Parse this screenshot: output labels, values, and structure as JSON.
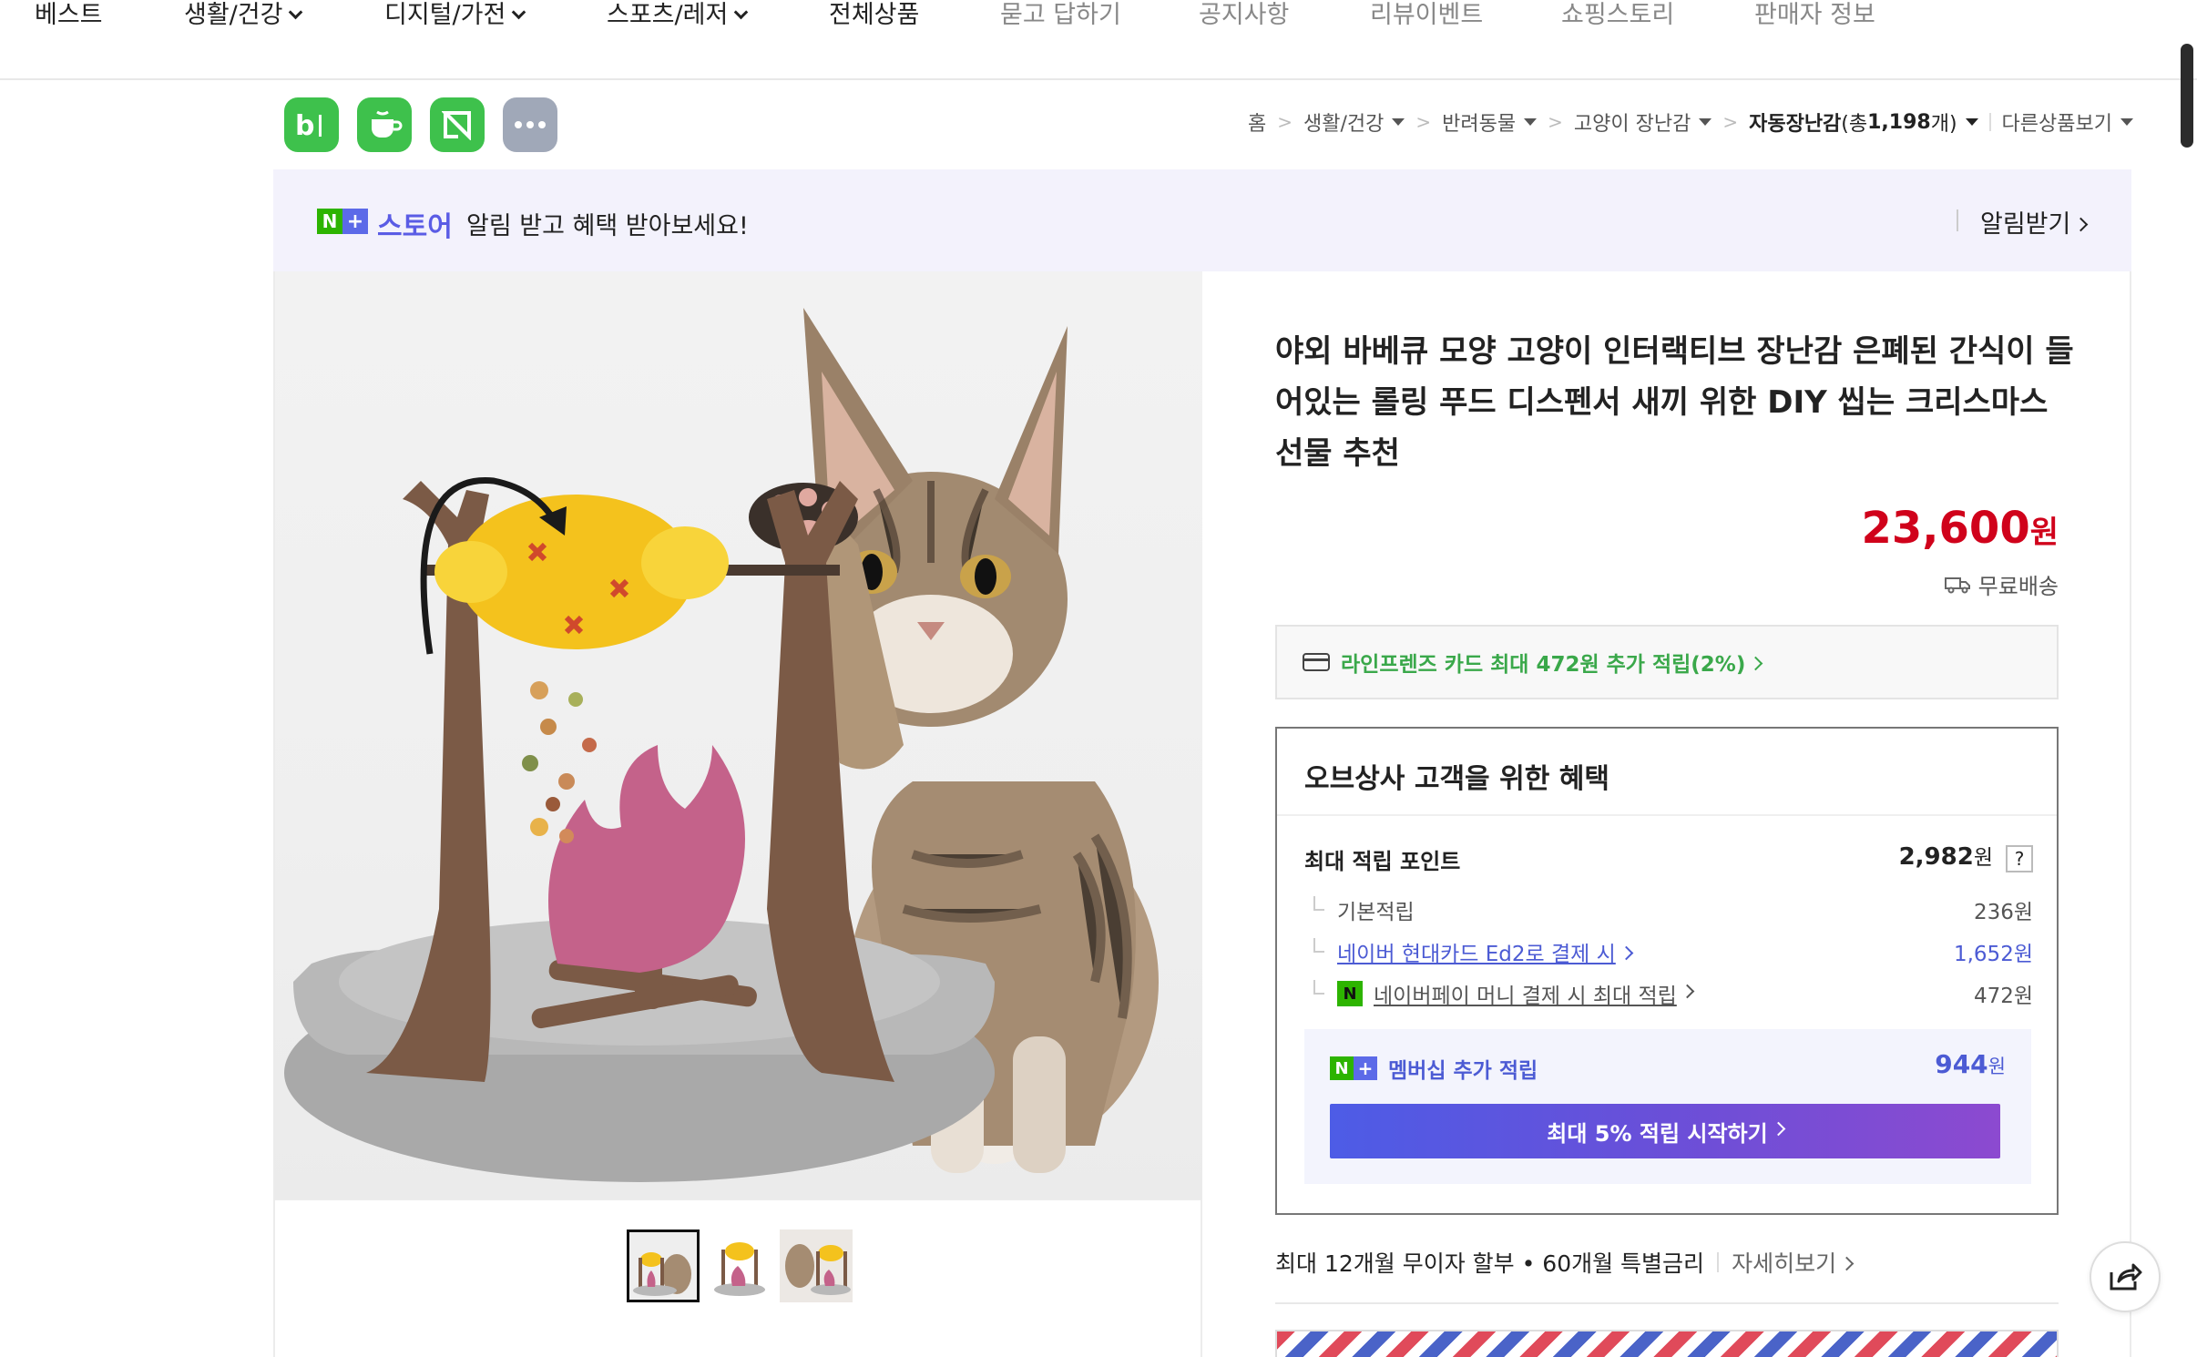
{
  "nav": {
    "items": [
      {
        "label": "베스트",
        "dropdown": false,
        "muted": false
      },
      {
        "label": "생활/건강",
        "dropdown": true,
        "muted": false
      },
      {
        "label": "디지털/가전",
        "dropdown": true,
        "muted": false
      },
      {
        "label": "스포츠/레저",
        "dropdown": true,
        "muted": false
      },
      {
        "label": "전체상품",
        "dropdown": false,
        "muted": false
      },
      {
        "label": "묻고 답하기",
        "dropdown": false,
        "muted": true
      },
      {
        "label": "공지사항",
        "dropdown": false,
        "muted": true
      },
      {
        "label": "리뷰이벤트",
        "dropdown": false,
        "muted": true
      },
      {
        "label": "쇼핑스토리",
        "dropdown": false,
        "muted": true
      },
      {
        "label": "판매자 정보",
        "dropdown": false,
        "muted": true
      }
    ]
  },
  "action_icons": [
    "blog-icon",
    "cafe-icon",
    "talktalk-icon",
    "more-icon"
  ],
  "breadcrumb": {
    "items": [
      "홈",
      "생활/건강",
      "반려동물",
      "고양이 장난감",
      "자동장난감"
    ],
    "count_prefix": "(총 ",
    "count_number": "1,198",
    "count_suffix": "개)",
    "other_products": "다른상품보기"
  },
  "banner": {
    "badge_n": "N",
    "badge_plus": "+",
    "store_label": "스토어",
    "message": "알림 받고 혜택 받아보세요!",
    "alarm_button": "알림받기"
  },
  "product": {
    "title": "야외 바베큐 모양 고양이 인터랙티브 장난감 은폐된 간식이 들어있는 롤링 푸드 디스펜서 새끼 위한 DIY 씹는 크리스마스 선물 추천",
    "price": "23,600",
    "currency": "원",
    "shipping": "무료배송",
    "thumbnails": 3,
    "active_thumbnail": 1
  },
  "card_offer": {
    "text": "라인프렌즈 카드 최대 472원 추가 적립(2%)"
  },
  "benefit": {
    "heading": "오브상사 고객을 위한 혜택",
    "max_points_label": "최대 적립 포인트",
    "max_points_value": "2,982",
    "max_points_unit": "원",
    "help": "?",
    "rows": [
      {
        "label": "기본적립",
        "value": "236원"
      },
      {
        "label": "네이버 현대카드 Ed2로 결제 시",
        "value": "1,652원"
      },
      {
        "label": "네이버페이 머니 결제 시 최대 적립",
        "value": "472원"
      }
    ],
    "npay_badge": "N",
    "membership_label": "멤버십 추가 적립",
    "membership_value": "944",
    "membership_unit": "원",
    "membership_button": "최대 5% 적립 시작하기"
  },
  "installment": {
    "text": "최대 12개월 무이자 할부 • 60개월 특별금리",
    "more": "자세히보기"
  },
  "colors": {
    "price": "#d0021b",
    "naver_green": "#2db400",
    "membership_blue": "#4c5bd4",
    "banner_bg": "#f3f2fc"
  }
}
